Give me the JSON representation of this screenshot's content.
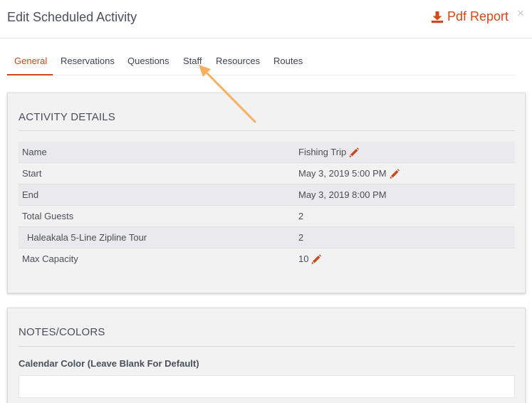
{
  "header": {
    "title": "Edit Scheduled Activity",
    "pdf_label": "Pdf Report",
    "close_glyph": "×"
  },
  "tabs": [
    {
      "label": "General",
      "active": true
    },
    {
      "label": "Reservations",
      "active": false
    },
    {
      "label": "Questions",
      "active": false
    },
    {
      "label": "Staff",
      "active": false
    },
    {
      "label": "Resources",
      "active": false
    },
    {
      "label": "Routes",
      "active": false
    }
  ],
  "activity_details": {
    "title": "ACTIVITY DETAILS",
    "rows": [
      {
        "label": "Name",
        "value": "Fishing Trip",
        "editable": true
      },
      {
        "label": "Start",
        "value": "May 3, 2019 5:00 PM",
        "editable": true
      },
      {
        "label": "End",
        "value": "May 3, 2019 8:00 PM",
        "editable": false
      },
      {
        "label": "Total Guests",
        "value": "2",
        "editable": false
      },
      {
        "label": "Haleakala 5-Line Zipline Tour",
        "value": "2",
        "editable": false
      },
      {
        "label": "Max Capacity",
        "value": "10",
        "editable": true
      }
    ]
  },
  "notes_colors": {
    "title": "NOTES/COLORS",
    "calendar_color_label": "Calendar Color (Leave Blank For Default)",
    "calendar_color_value": ""
  },
  "icons": {
    "pdf": "download-icon",
    "edit": "pencil-icon",
    "close": "close-icon",
    "annotation": "arrow-annotation"
  },
  "colors": {
    "accent": "#d0481b",
    "arrow": "#f5b062",
    "panel_bg": "#f2f2f2",
    "row_shade": "#e9e9ee"
  }
}
